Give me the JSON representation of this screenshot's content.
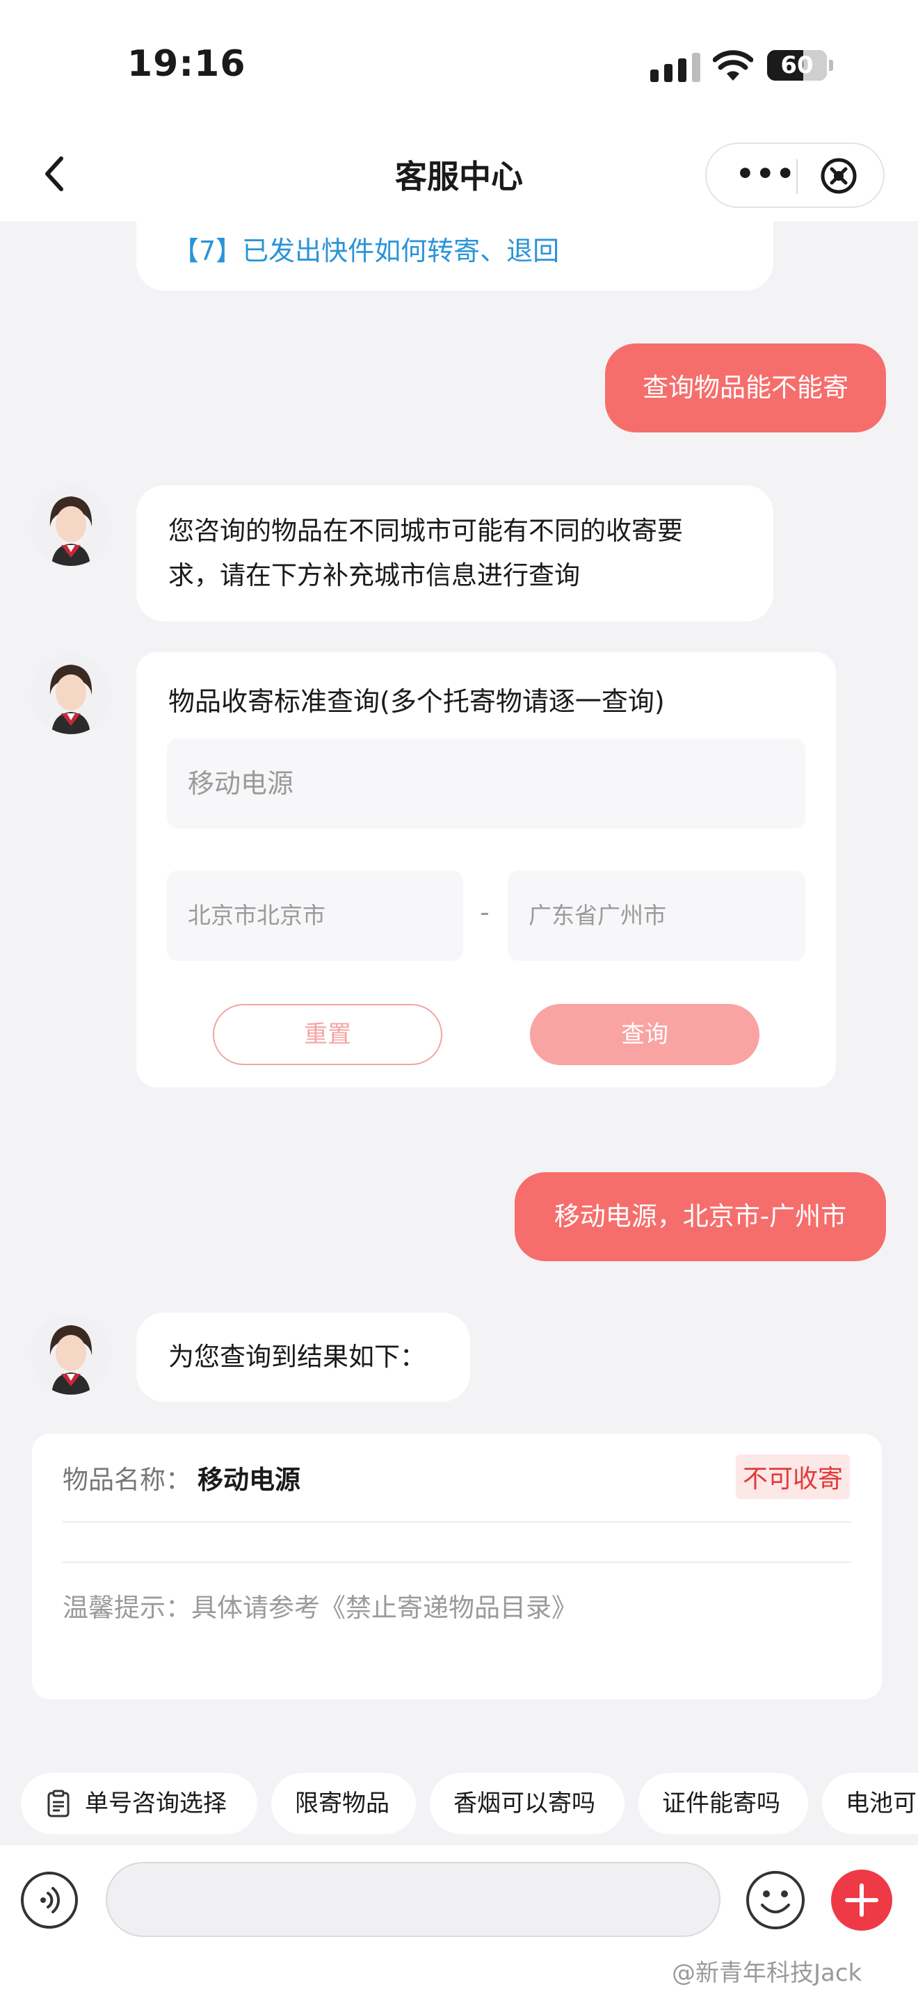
{
  "status_bar": {
    "time": "19:16",
    "battery": "60"
  },
  "nav": {
    "title": "客服中心"
  },
  "chat": {
    "prev_link": "【7】已发出快件如何转寄、退回",
    "user_msg_1": "查询物品能不能寄",
    "bot_msg_1_line1": "您咨询的物品在不同城市可能有不同的收寄要",
    "bot_msg_1_line2": "求，请在下方补充城市信息进行查询",
    "form": {
      "title": "物品收寄标准查询(多个托寄物请逐一查询)",
      "item_placeholder": "移动电源",
      "from_placeholder": "北京市北京市",
      "separator": "-",
      "to_placeholder": "广东省广州市",
      "reset_label": "重置",
      "query_label": "查询"
    },
    "user_msg_2": "移动电源，北京市-广州市",
    "bot_msg_2": "为您查询到结果如下：",
    "result": {
      "name_label": "物品名称：",
      "name_value": "移动电源",
      "status": "不可收寄",
      "tip": "温馨提示：具体请参考《禁止寄递物品目录》"
    }
  },
  "quick_chips": [
    "单号咨询选择",
    "限寄物品",
    "香烟可以寄吗",
    "证件能寄吗",
    "电池可"
  ],
  "watermark": "@新青年科技Jack",
  "colors": {
    "accent": "#f56e6c",
    "link": "#2a94d8",
    "status_red": "#e23a3a"
  }
}
